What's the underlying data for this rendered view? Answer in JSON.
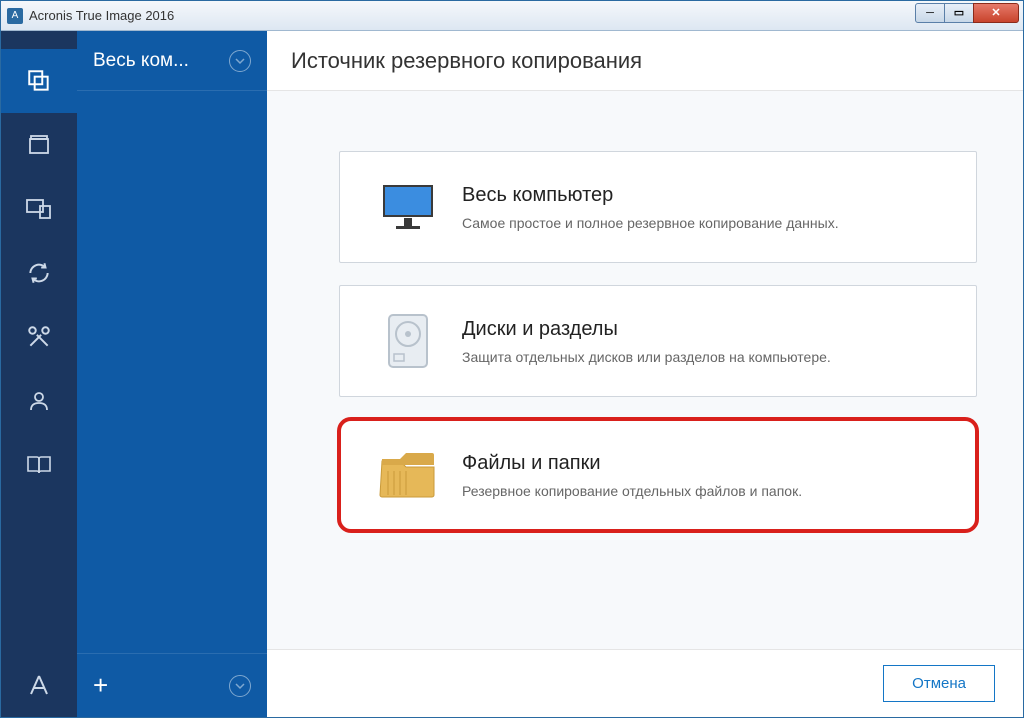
{
  "window": {
    "title": "Acronis True Image 2016",
    "icon_letter": "A"
  },
  "context": {
    "header_label": "Весь ком..."
  },
  "page": {
    "title": "Источник резервного копирования"
  },
  "cards": {
    "computer": {
      "title": "Весь компьютер",
      "desc": "Самое простое и полное резервное копирование данных."
    },
    "disks": {
      "title": "Диски и разделы",
      "desc": "Защита отдельных дисков или разделов на компьютере."
    },
    "files": {
      "title": "Файлы и папки",
      "desc": "Резервное копирование отдельных файлов и папок."
    }
  },
  "buttons": {
    "cancel": "Отмена"
  }
}
